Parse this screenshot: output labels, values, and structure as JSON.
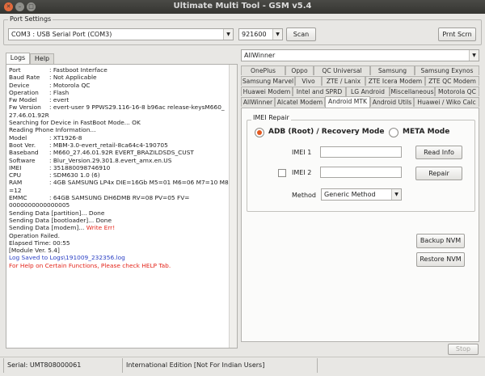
{
  "window": {
    "title": "Ultimate Multi Tool - GSM v5.4"
  },
  "port_settings": {
    "label": "Port Settings",
    "port_value": "COM3 : USB Serial Port (COM3)",
    "baud_value": "921600",
    "scan_label": "Scan",
    "print_label": "Prnt Scrn"
  },
  "left_tabs": [
    "Logs",
    "Help"
  ],
  "log": {
    "fields": [
      {
        "k": "Port",
        "v": ": Fastboot Interface"
      },
      {
        "k": "Baud Rate",
        "v": ": Not Applicable"
      },
      {
        "k": "Device",
        "v": ": Motorola QC"
      },
      {
        "k": "Operation",
        "v": ": Flash"
      },
      {
        "k": "Fw Model",
        "v": ": evert"
      },
      {
        "k": "Fw Version",
        "v": ": evert-user 9 PPWS29.116-16-8 b96ac release-keysM660_"
      }
    ],
    "line_fw_cont": "27.46.01.92R",
    "line_search": "Searching for Device in FastBoot Mode... OK",
    "line_reading": "Reading Phone Information...",
    "info": [
      {
        "k": "Model",
        "v": ": XT1926-8"
      },
      {
        "k": "Boot Ver.",
        "v": ": MBM-3.0-evert_retail-8ca64c4-190705"
      },
      {
        "k": "Baseband",
        "v": ": M660_27.46.01.92R EVERT_BRAZILDSDS_CUST"
      },
      {
        "k": "Software",
        "v": ": Blur_Version.29.301.8.evert_amx.en.US"
      },
      {
        "k": "IMEI",
        "v": ": 351880098746910"
      },
      {
        "k": "CPU",
        "v": ": SDM630 1.0 (6)"
      },
      {
        "k": "RAM",
        "v": ": 4GB SAMSUNG LP4x DIE=16Gb M5=01 M6=06 M7=10 M8"
      }
    ],
    "line_ram_cont": "=12",
    "emmc": {
      "k": "EMMC",
      "v": ": 64GB SAMSUNG DH6DMB RV=08 PV=05 FV="
    },
    "line_emmc_cont": "0000000000000005",
    "line_send1": "Sending Data [partition]... Done",
    "line_send2": "Sending Data [bootloader]... Done",
    "line_send3": "Sending Data [modem]... ",
    "line_send3_err": "Write Err!",
    "line_failed": "Operation Failed.",
    "line_elapsed": "Elapsed Time: 00:55",
    "line_module": "[Module Ver. 5.4]",
    "line_saved": "Log Saved to Logs\\191009_232356.log",
    "line_help": "For Help on Certain Functions, Please check HELP Tab."
  },
  "brand_combo": "AllWinner",
  "tabs_row1": [
    "OnePlus",
    "Oppo",
    "QC Universal",
    "Samsung",
    "Samsung Exynos"
  ],
  "tabs_row2": [
    "Samsung Marvel",
    "Vivo",
    "ZTE / Lanix",
    "ZTE Icera Modem",
    "ZTE QC Modem"
  ],
  "tabs_row3": [
    "Huawei Modem",
    "Intel and SPRD",
    "LG Android",
    "Miscellaneous",
    "Motorola QC"
  ],
  "tabs_row4": [
    "AllWinner",
    "Alcatel Modem",
    "Android MTK",
    "Android Utils",
    "Huawei / Wiko Calc"
  ],
  "imei_repair": {
    "group_label": "IMEI Repair",
    "adb_label": "ADB (Root) / Recovery Mode",
    "meta_label": "META Mode",
    "imei1_label": "IMEI 1",
    "imei2_label": "IMEI 2",
    "read_info_label": "Read Info",
    "repair_label": "Repair",
    "method_label": "Method",
    "method_value": "Generic Method"
  },
  "nvm": {
    "backup_label": "Backup NVM",
    "restore_label": "Restore NVM"
  },
  "stop_label": "Stop",
  "status": {
    "serial": "Serial: UMT808000061",
    "edition": "International Edition [Not For Indian Users]"
  }
}
